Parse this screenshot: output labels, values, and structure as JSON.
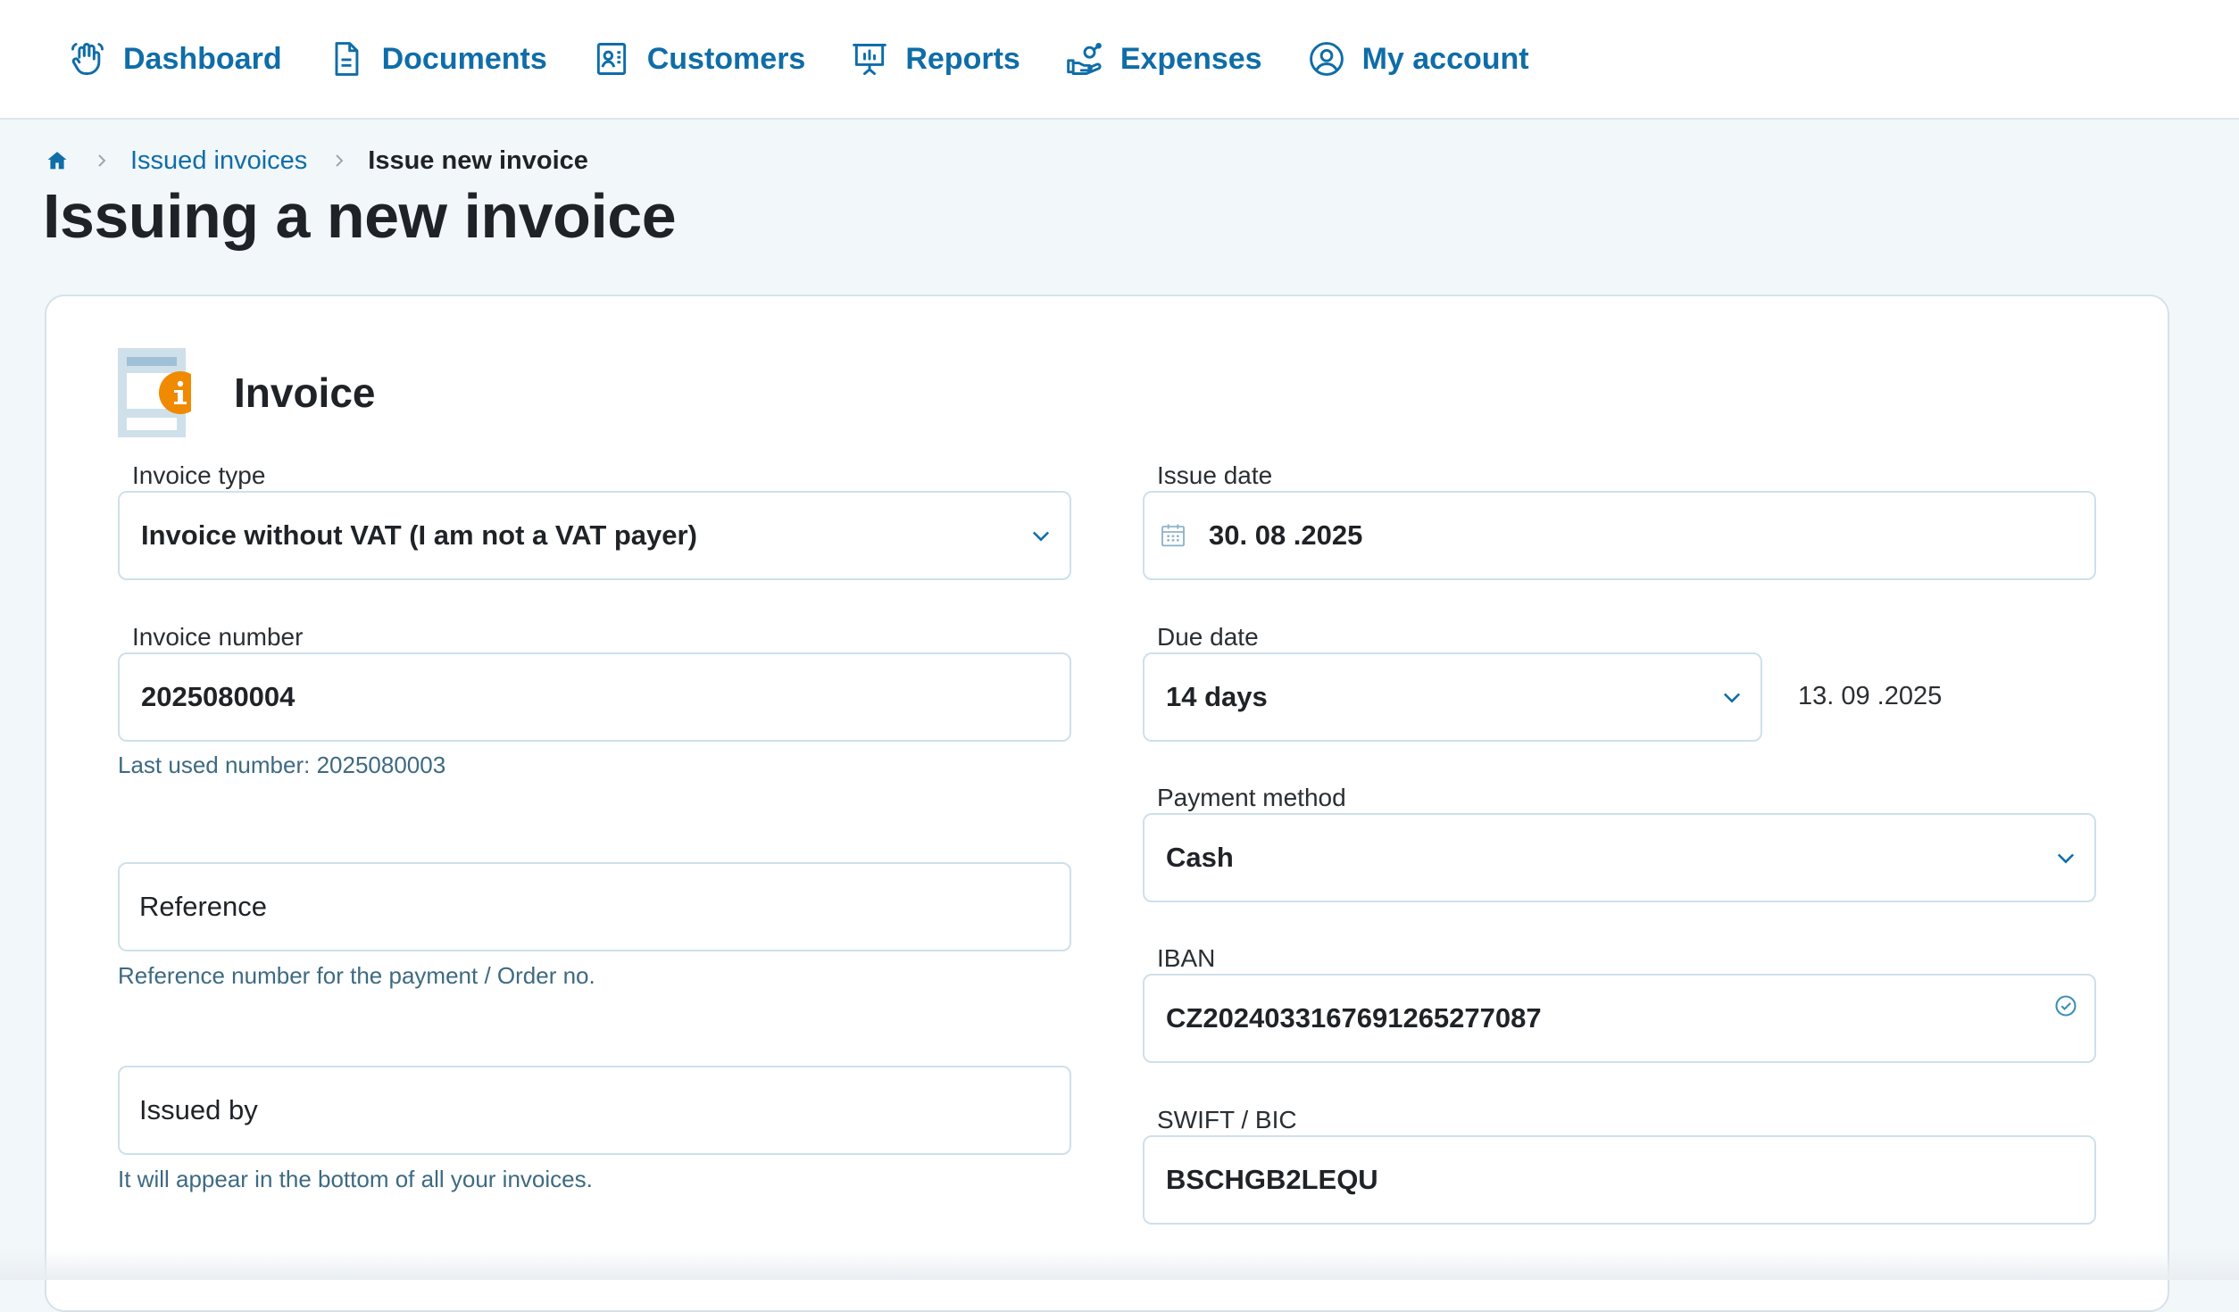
{
  "nav": {
    "items": [
      {
        "label": "Dashboard",
        "icon": "wave-hand-icon"
      },
      {
        "label": "Documents",
        "icon": "document-icon"
      },
      {
        "label": "Customers",
        "icon": "contact-card-icon"
      },
      {
        "label": "Reports",
        "icon": "presentation-chart-icon"
      },
      {
        "label": "Expenses",
        "icon": "hand-money-icon"
      },
      {
        "label": "My account",
        "icon": "user-circle-icon"
      }
    ]
  },
  "breadcrumb": {
    "home_icon": "home-icon",
    "parent": "Issued invoices",
    "current": "Issue new invoice"
  },
  "page": {
    "title": "Issuing a new invoice"
  },
  "card": {
    "title": "Invoice",
    "icon": "invoice-info-icon",
    "fields": {
      "invoice_type": {
        "label": "Invoice type",
        "value": "Invoice without VAT (I am not a VAT payer)"
      },
      "issue_date": {
        "label": "Issue date",
        "value": "30. 08 .2025"
      },
      "invoice_number": {
        "label": "Invoice number",
        "value": "2025080004",
        "help": "Last used number: 2025080003"
      },
      "due_date": {
        "label": "Due date",
        "value": "14 days",
        "computed": "13. 09 .2025"
      },
      "payment_method": {
        "label": "Payment method",
        "value": "Cash"
      },
      "reference": {
        "placeholder": "Reference",
        "help": "Reference number for the payment / Order no."
      },
      "iban": {
        "label": "IBAN",
        "value": "CZ2024033167691265277087"
      },
      "issued_by": {
        "placeholder": "Issued by",
        "help": "It will appear in the bottom of all your invoices."
      },
      "swift": {
        "label": "SWIFT / BIC",
        "value": "BSCHGB2LEQU"
      }
    }
  },
  "colors": {
    "accent": "#0f6da8",
    "badge": "#f08a00",
    "border": "#cfe0ea",
    "background": "#f2f7fa"
  }
}
